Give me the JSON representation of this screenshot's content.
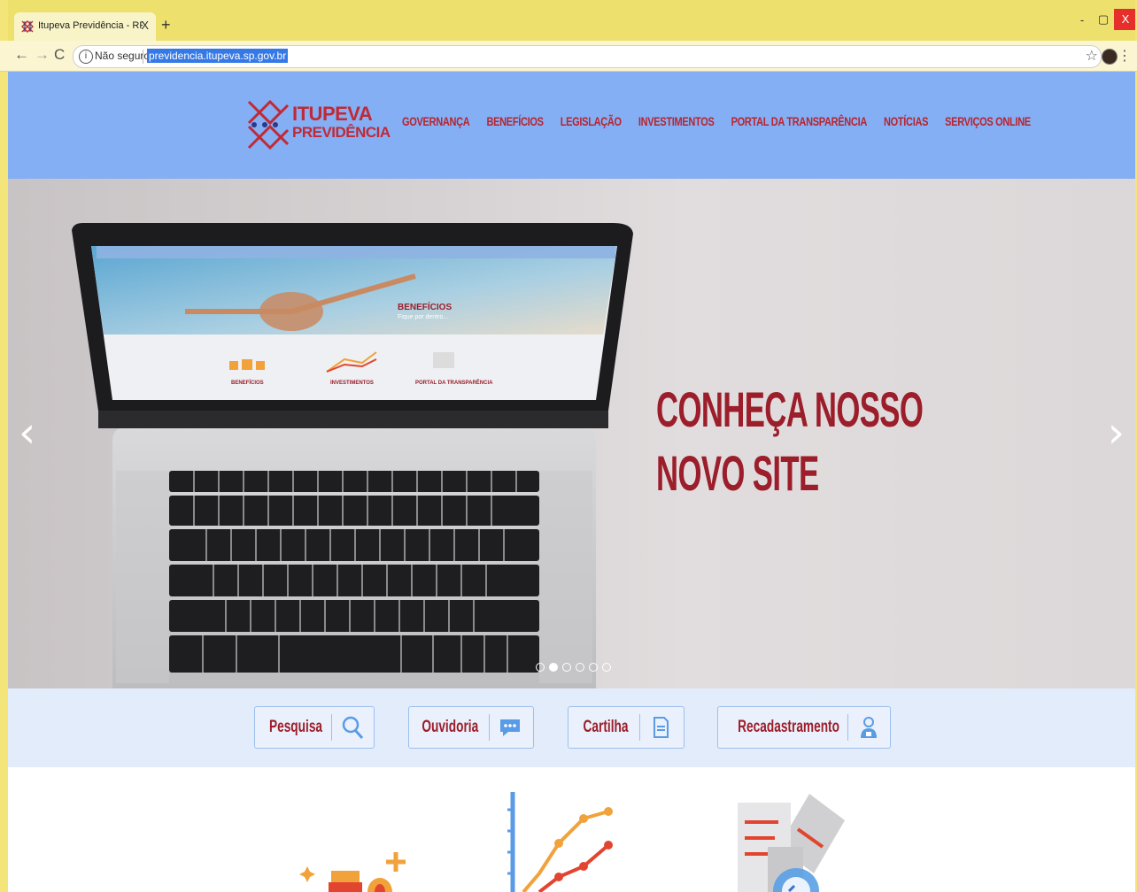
{
  "browser": {
    "tab_title": "Itupeva Previdência - RPPS do m",
    "tab_close": "X",
    "new_tab": "+",
    "security_label": "Não seguro",
    "url": "previdencia.itupeva.sp.gov.br",
    "window_controls": [
      "-",
      "▢",
      "X"
    ]
  },
  "site": {
    "logo_line1": "ITUPEVA",
    "logo_line2": "PREVIDÊNCIA",
    "nav": [
      "GOVERNANÇA",
      "BENEFÍCIOS",
      "LEGISLAÇÃO",
      "INVESTIMENTOS",
      "PORTAL DA TRANSPARÊNCIA",
      "NOTÍCIAS",
      "SERVIÇOS ONLINE"
    ]
  },
  "hero": {
    "headline_line1": "CONHEÇA NOSSO",
    "headline_line2": "NOVO SITE",
    "screen_heading": "BENEFÍCIOS",
    "screen_subheading": "Fique por dentro...",
    "screen_labels": [
      "BENEFÍCIOS",
      "INVESTIMENTOS",
      "PORTAL DA TRANSPARÊNCIA"
    ],
    "slide_count": 6,
    "active_slide": 2
  },
  "quick_links": [
    {
      "label": "Pesquisa",
      "icon": "search-icon"
    },
    {
      "label": "Ouvidoria",
      "icon": "chat-icon"
    },
    {
      "label": "Cartilha",
      "icon": "document-icon"
    },
    {
      "label": "Recadastramento",
      "icon": "person-icon"
    }
  ],
  "colors": {
    "header_bg": "#84aff4",
    "brand_red": "#9b1e2a",
    "browser_frame": "#ede06c"
  }
}
